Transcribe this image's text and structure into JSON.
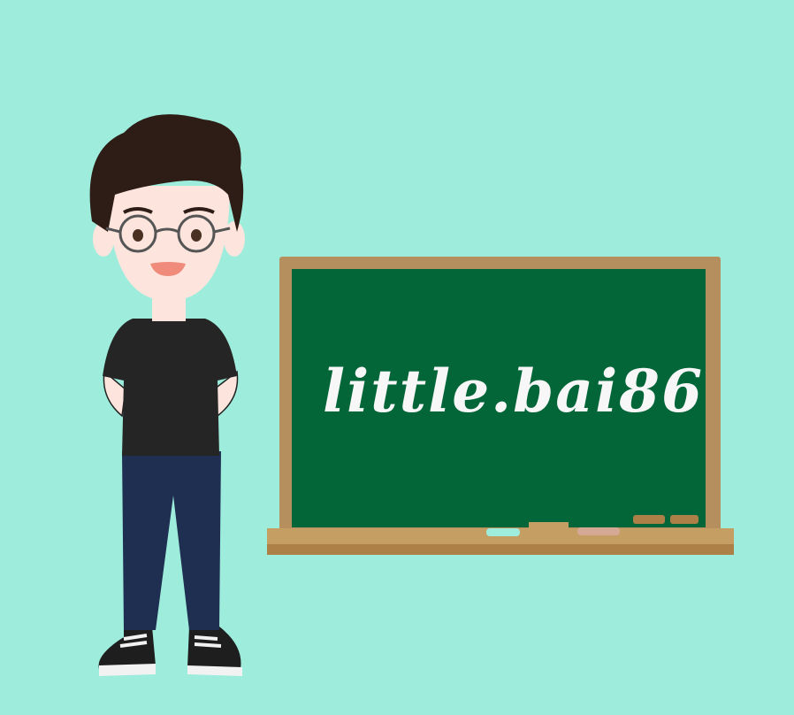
{
  "chalkboard": {
    "text": "little.bai86"
  },
  "colors": {
    "background": "#9eeddc",
    "board_green": "#026638",
    "frame_wood": "#b5905e",
    "ledge_wood": "#c49e62",
    "chalk": "#f7f7f7",
    "hair": "#2e1d17",
    "shirt": "#252525",
    "jeans": "#1e2f52",
    "skin": "#fde4dd"
  }
}
